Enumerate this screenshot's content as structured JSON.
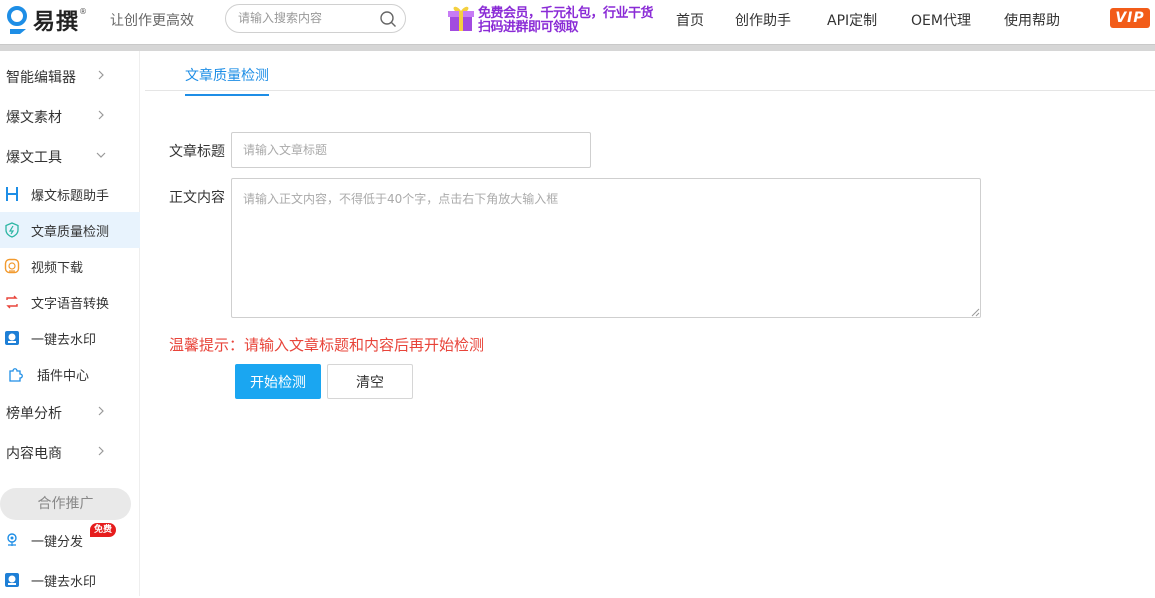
{
  "header": {
    "logo_text": "易撰",
    "logo_reg": "®",
    "slogan": "让创作更高效",
    "search_placeholder": "请输入搜索内容",
    "promo_line1": "免费会员，千元礼包，行业干货",
    "promo_line2": "扫码进群即可领取",
    "nav": [
      "首页",
      "创作助手",
      "API定制",
      "OEM代理",
      "使用帮助"
    ],
    "vip_label": "VIP"
  },
  "sidebar": {
    "groups": [
      {
        "label": "智能编辑器"
      },
      {
        "label": "爆文素材"
      },
      {
        "label": "爆文工具"
      }
    ],
    "tools": [
      {
        "label": "爆文标题助手",
        "icon": "h-letter-icon"
      },
      {
        "label": "文章质量检测",
        "icon": "shield-icon",
        "active": true
      },
      {
        "label": "视频下载",
        "icon": "video-download-icon"
      },
      {
        "label": "文字语音转换",
        "icon": "convert-icon"
      },
      {
        "label": "一键去水印",
        "icon": "watermark-icon"
      },
      {
        "label": "插件中心",
        "icon": "puzzle-icon"
      }
    ],
    "groups2": [
      {
        "label": "榜单分析"
      },
      {
        "label": "内容电商"
      }
    ],
    "coop_label": "合作推广",
    "coop_items": [
      {
        "label": "一键分发",
        "icon": "distribute-icon",
        "badge": "免费"
      },
      {
        "label": "一键去水印",
        "icon": "watermark-icon"
      }
    ]
  },
  "main": {
    "tab_label": "文章质量检测",
    "title_label": "文章标题",
    "title_placeholder": "请输入文章标题",
    "content_label": "正文内容",
    "content_placeholder": "请输入正文内容，不得低于40个字，点击右下角放大输入框",
    "tip": "温馨提示：请输入文章标题和内容后再开始检测",
    "start_button": "开始检测",
    "clear_button": "清空"
  },
  "colors": {
    "accent": "#1e8ee6",
    "button_primary": "#1aa6f1",
    "tip_red": "#e8443a",
    "vip_orange": "#f25c19"
  }
}
